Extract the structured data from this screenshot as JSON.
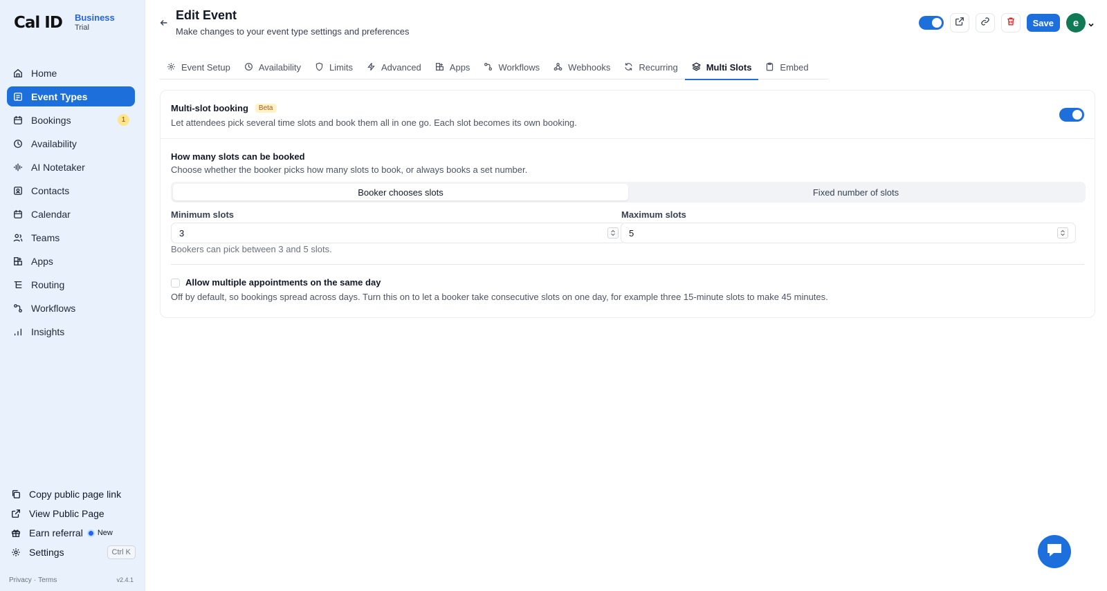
{
  "brand": {
    "logo": "Cal ID",
    "plan": "Business",
    "plan_sub": "Trial"
  },
  "sidebar": {
    "items": [
      {
        "label": "Home",
        "icon": "home-icon"
      },
      {
        "label": "Event Types",
        "icon": "event-types-icon",
        "active": true
      },
      {
        "label": "Bookings",
        "icon": "calendar-icon",
        "badge": "1"
      },
      {
        "label": "Availability",
        "icon": "clock-icon"
      },
      {
        "label": "AI Notetaker",
        "icon": "waveform-icon"
      },
      {
        "label": "Contacts",
        "icon": "contacts-icon"
      },
      {
        "label": "Calendar",
        "icon": "calendar-icon"
      },
      {
        "label": "Teams",
        "icon": "users-icon"
      },
      {
        "label": "Apps",
        "icon": "apps-icon"
      },
      {
        "label": "Routing",
        "icon": "routing-icon"
      },
      {
        "label": "Workflows",
        "icon": "workflows-icon"
      },
      {
        "label": "Insights",
        "icon": "bar-chart-icon"
      }
    ],
    "bottom": {
      "copy_link": "Copy public page link",
      "view_public": "View Public Page",
      "earn_referral": "Earn referral",
      "new_label": "New",
      "settings": "Settings",
      "shortcut": "Ctrl K"
    },
    "footer": {
      "privacy": "Privacy",
      "sep": "·",
      "terms": "Terms",
      "version": "v2.4.1"
    }
  },
  "header": {
    "title": "Edit Event",
    "subtitle": "Make changes to your event type settings and preferences",
    "save_label": "Save",
    "avatar_letter": "e"
  },
  "tabs": [
    {
      "label": "Event Setup",
      "icon": "gear-icon"
    },
    {
      "label": "Availability",
      "icon": "clock-icon"
    },
    {
      "label": "Limits",
      "icon": "shield-icon"
    },
    {
      "label": "Advanced",
      "icon": "bolt-icon"
    },
    {
      "label": "Apps",
      "icon": "apps-icon"
    },
    {
      "label": "Workflows",
      "icon": "workflows-icon"
    },
    {
      "label": "Webhooks",
      "icon": "webhook-icon"
    },
    {
      "label": "Recurring",
      "icon": "refresh-icon"
    },
    {
      "label": "Multi Slots",
      "icon": "layers-icon",
      "active": true
    },
    {
      "label": "Embed",
      "icon": "clipboard-icon"
    }
  ],
  "multislot": {
    "title": "Multi-slot booking",
    "beta": "Beta",
    "description": "Let attendees pick several time slots and book them all in one go. Each slot becomes its own booking.",
    "enabled": true,
    "how_many_title": "How many slots can be booked",
    "how_many_desc": "Choose whether the booker picks how many slots to book, or always books a set number.",
    "mode_options": [
      "Booker chooses slots",
      "Fixed number of slots"
    ],
    "mode_selected": "Booker chooses slots",
    "min_label": "Minimum slots",
    "min_value": "3",
    "max_label": "Maximum slots",
    "max_value": "5",
    "range_text": "Bookers can pick between 3 and 5 slots.",
    "same_day_label": "Allow multiple appointments on the same day",
    "same_day_checked": false,
    "same_day_desc": "Off by default, so bookings spread across days. Turn this on to let a booker take consecutive slots on one day, for example three 15-minute slots to make 45 minutes."
  },
  "colors": {
    "accent": "#1d6fdc",
    "sidebar_bg": "#e9f1fc",
    "danger": "#dc2626",
    "avatar": "#0f7a55"
  }
}
